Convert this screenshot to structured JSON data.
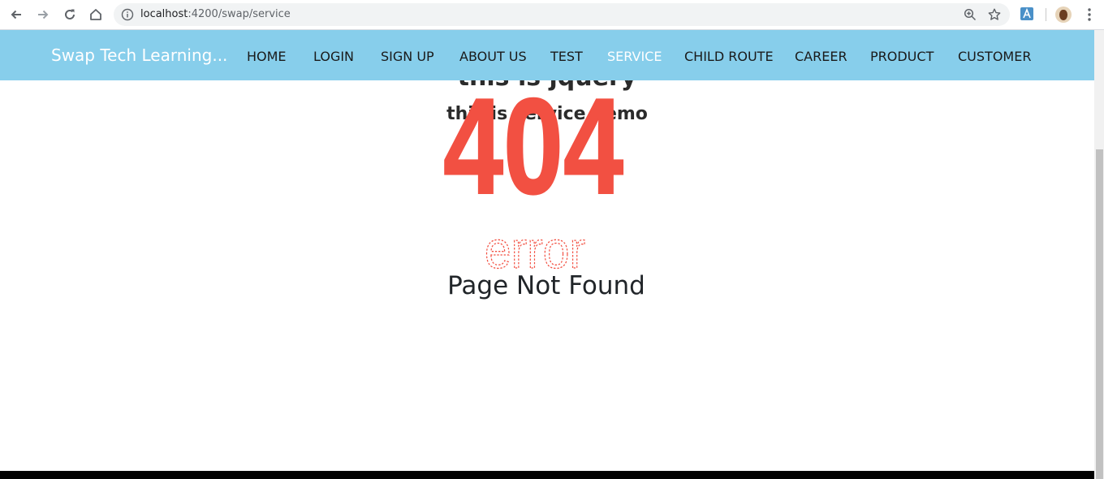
{
  "browser": {
    "url_host": "localhost",
    "url_rest": ":4200/swap/service"
  },
  "navbar": {
    "brand": "Swap Tech Learning...",
    "items": [
      {
        "label": "HOME",
        "active": false
      },
      {
        "label": "LOGIN",
        "active": false
      },
      {
        "label": "SIGN UP",
        "active": false
      },
      {
        "label": "ABOUT US",
        "active": false
      },
      {
        "label": "TEST",
        "active": false
      },
      {
        "label": "SERVICE",
        "active": true
      },
      {
        "label": "CHILD ROUTE",
        "active": false
      },
      {
        "label": "CAREER",
        "active": false
      },
      {
        "label": "PRODUCT",
        "active": false
      },
      {
        "label": "CUSTOMER",
        "active": false
      }
    ]
  },
  "content": {
    "heading_jquery": "this is jquery",
    "heading_service": "this is service demo",
    "error_code": "404",
    "error_word": "error",
    "not_found": "Page Not Found"
  },
  "colors": {
    "navbar_bg": "#87ceeb",
    "error_red": "#f25042"
  }
}
